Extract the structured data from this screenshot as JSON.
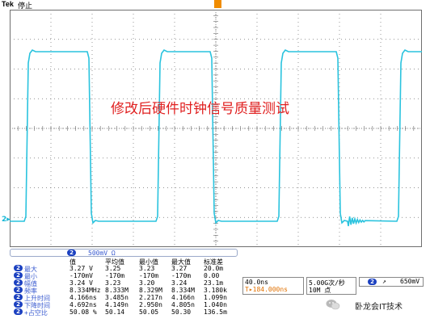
{
  "scope": {
    "brand": "Tek",
    "run_state": "停止",
    "overlay_title": "修改后硬件时钟信号质量测试",
    "channel_marker": "2▸",
    "colors": {
      "trace": "#2ac3de",
      "grid": "#6f6f6f",
      "title": "#e02020",
      "label": "#3a5bd0",
      "badge": "#1b40c0",
      "trigger": "#f08c00"
    },
    "waveform": {
      "type": "square clock",
      "channel": "2",
      "frequency": "8.334MHz",
      "high_level": "3.27 V",
      "low_level": "-170mV",
      "volts_per_div": "500mV",
      "time_per_div": "40.0ns"
    }
  },
  "measurements": {
    "channel": "2",
    "scale": "500mV Ω",
    "headers": [
      "值",
      "平均值",
      "最小值",
      "最大值",
      "标准差"
    ],
    "rows": [
      {
        "label": "最大",
        "values": [
          "3.27 V",
          "3.25",
          "3.23",
          "3.27",
          "20.0m"
        ]
      },
      {
        "label": "最小",
        "values": [
          "-170mV",
          "-170m",
          "-170m",
          "-170m",
          "0.00"
        ]
      },
      {
        "label": "幅值",
        "values": [
          "3.24 V",
          "3.23",
          "3.20",
          "3.24",
          "23.1m"
        ]
      },
      {
        "label": "频率",
        "values": [
          "8.334MHz",
          "8.333M",
          "8.329M",
          "8.334M",
          "3.180k"
        ]
      },
      {
        "label": "上升时间",
        "values": [
          "4.166ns",
          "3.485n",
          "2.217n",
          "4.166n",
          "1.099n"
        ]
      },
      {
        "label": "下降时间",
        "values": [
          "4.692ns",
          "4.149n",
          "2.950n",
          "4.805n",
          "1.040n"
        ]
      },
      {
        "label": "+占空比",
        "values": [
          "50.08 %",
          "50.14",
          "50.05",
          "50.30",
          "136.5m"
        ]
      }
    ]
  },
  "timebase": {
    "per_div": "40.0ns",
    "position": "T▸184.000ns"
  },
  "acquisition": {
    "rate": "5.00G次/秒",
    "points": "10M 点"
  },
  "trigger": {
    "channel": "2",
    "slope": "↗",
    "level": "650mV"
  },
  "watermark": {
    "text": "卧龙会IT技术",
    "icon": "wechat-icon"
  }
}
